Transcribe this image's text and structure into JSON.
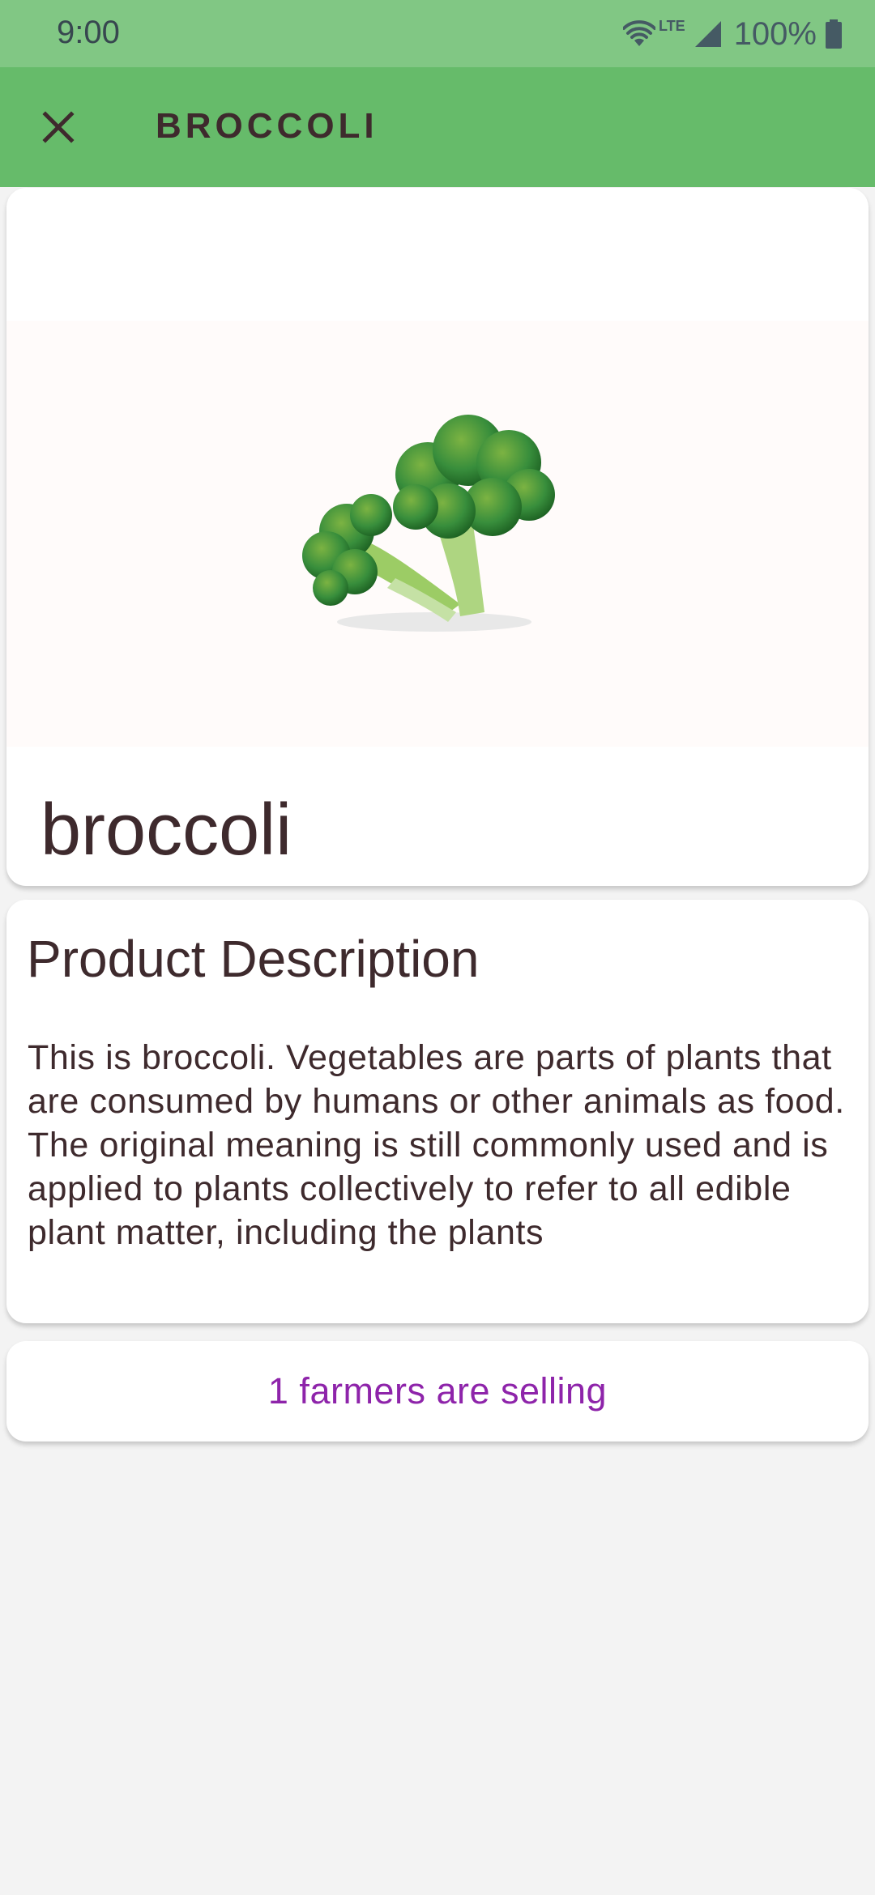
{
  "status_bar": {
    "time": "9:00",
    "network": "LTE",
    "battery": "100%"
  },
  "app_bar": {
    "title": "BROCCOLI",
    "close_icon": "close-icon"
  },
  "product": {
    "image_icon": "broccoli-image",
    "name": "broccoli"
  },
  "description": {
    "title": "Product Description",
    "text": "This is broccoli. Vegetables are parts of plants that are consumed by humans or other animals as food. The original meaning is still commonly used and is applied to plants collectively to refer to all edible plant matter, including the plants"
  },
  "sellers": {
    "label": "1 farmers are selling",
    "color": "#8e24aa"
  },
  "colors": {
    "status_bar": "#81c784",
    "app_bar": "#66bb6a",
    "text": "#3e2a2d",
    "background": "#f3f3f3"
  }
}
